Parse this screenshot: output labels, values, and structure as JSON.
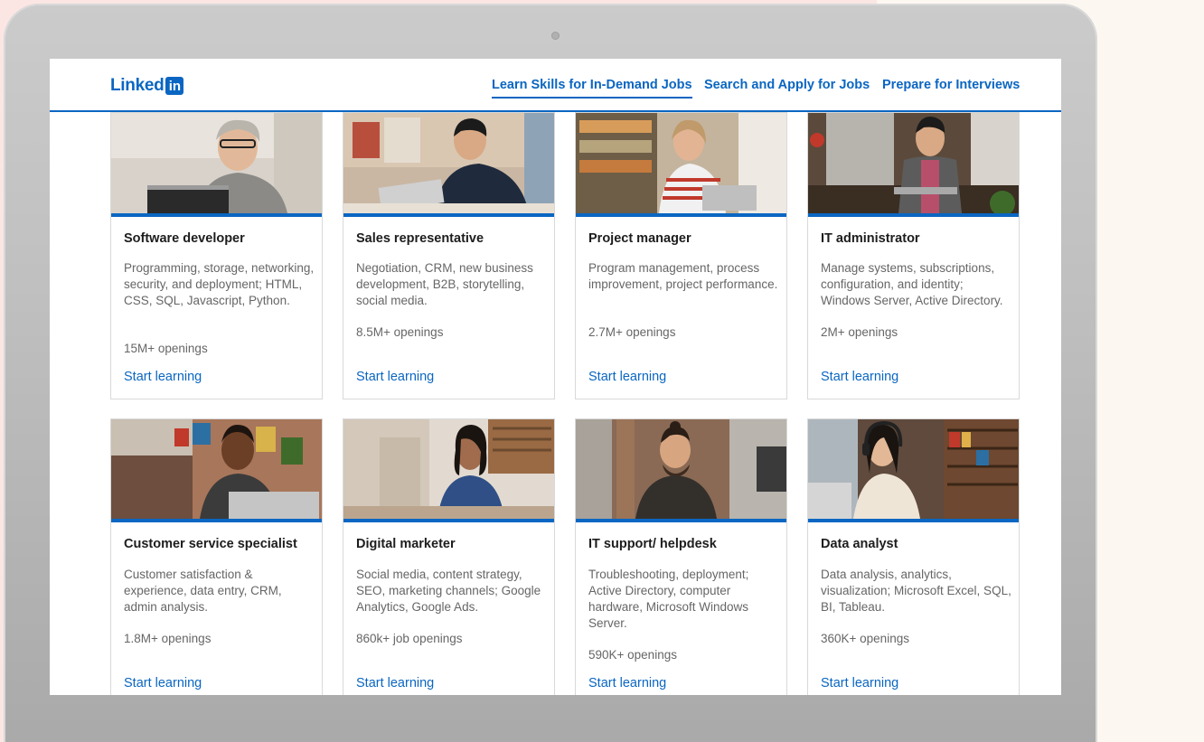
{
  "brand": {
    "wordmark": "Linked",
    "badge": "in",
    "color": "#0a66c2"
  },
  "nav": {
    "items": [
      {
        "label": "Learn Skills for In-Demand Jobs",
        "active": true
      },
      {
        "label": "Search and Apply for Jobs",
        "active": false
      },
      {
        "label": "Prepare for Interviews",
        "active": false
      }
    ]
  },
  "cards": [
    {
      "title": "Software developer",
      "description": "Programming, storage, networking, security, and deployment; HTML, CSS, SQL, Javascript, Python.",
      "openings": "15M+ openings",
      "cta": "Start learning",
      "photo_icon": "woman-with-glasses-laptop-photo"
    },
    {
      "title": "Sales representative",
      "description": "Negotiation, CRM, new business development, B2B, storytelling, social media.",
      "openings": "8.5M+ openings",
      "cta": "Start learning",
      "photo_icon": "man-on-phone-laptop-photo"
    },
    {
      "title": "Project manager",
      "description": "Program management, process improvement, project performance.",
      "openings": "2.7M+ openings",
      "cta": "Start learning",
      "photo_icon": "woman-in-shop-laptop-photo"
    },
    {
      "title": "IT administrator",
      "description": "Manage systems, subscriptions, configuration, and identity; Windows Server, Active Directory.",
      "openings": "2M+ openings",
      "cta": "Start learning",
      "photo_icon": "man-standing-laptop-photo"
    },
    {
      "title": "Customer service specialist",
      "description": "Customer satisfaction & experience, data entry, CRM, admin analysis.",
      "openings": "1.8M+ openings",
      "cta": "Start learning",
      "photo_icon": "smiling-woman-laptop-photo"
    },
    {
      "title": "Digital marketer",
      "description": "Social media, content strategy, SEO, marketing channels; Google Analytics, Google Ads.",
      "openings": "860k+ job openings",
      "cta": "Start learning",
      "photo_icon": "woman-at-desk-photo"
    },
    {
      "title": "IT support/ helpdesk",
      "description": "Troubleshooting, deployment; Active Directory, computer hardware, Microsoft Windows Server.",
      "openings": "590K+ openings",
      "cta": "Start learning",
      "photo_icon": "bearded-man-computer-photo"
    },
    {
      "title": "Data analyst",
      "description": "Data analysis, analytics, visualization; Microsoft Excel, SQL, BI, Tableau.",
      "openings": "360K+ openings",
      "cta": "Start learning",
      "photo_icon": "woman-with-headphones-laptop-photo"
    }
  ]
}
